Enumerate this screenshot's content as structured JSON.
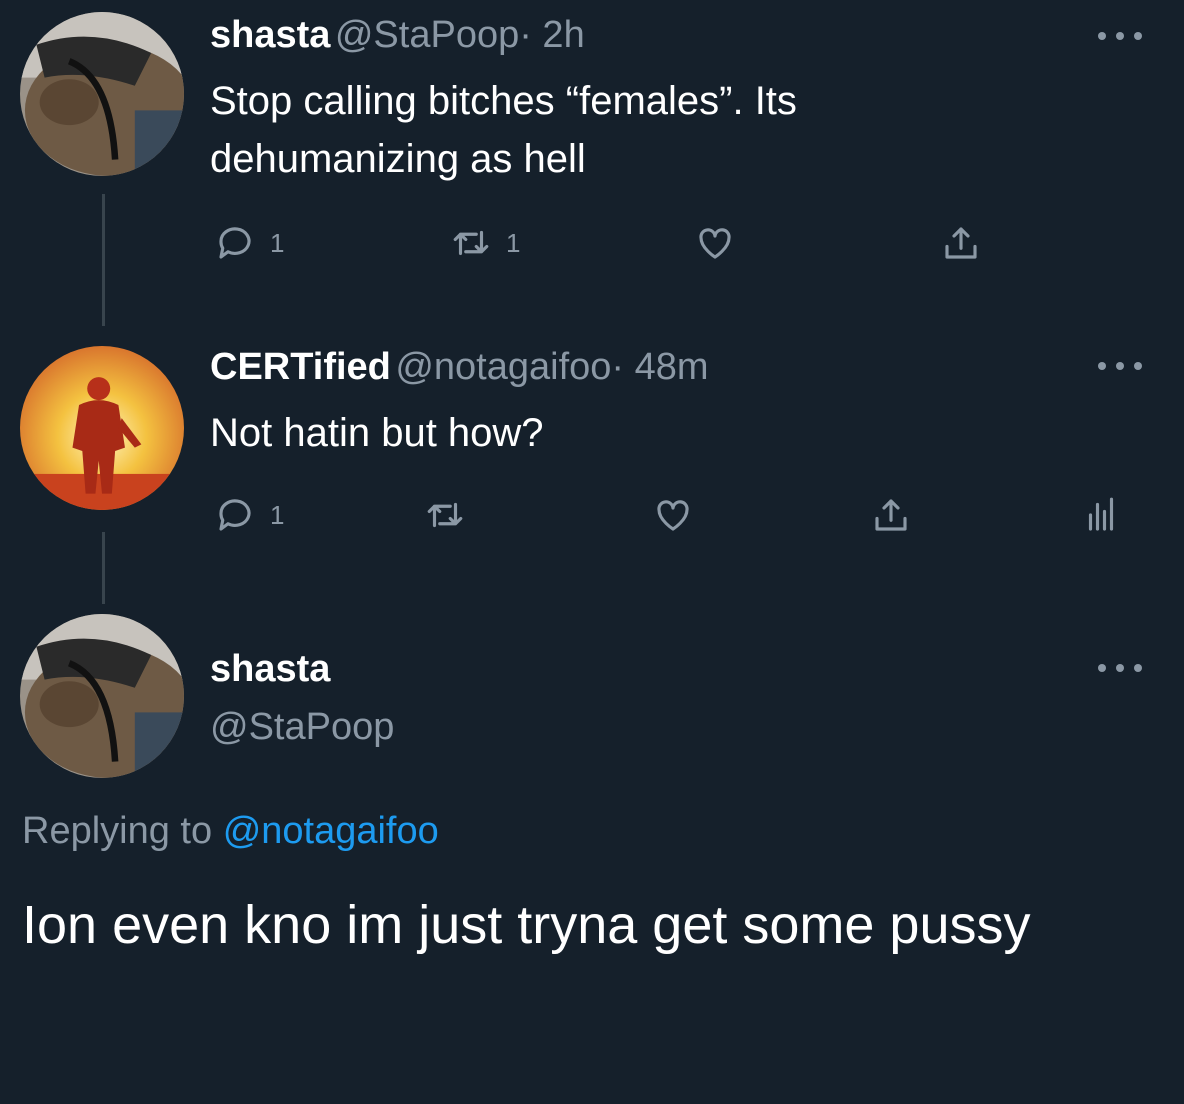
{
  "tweets": [
    {
      "name": "shasta",
      "handle": "@StaPoop",
      "time": "· 2h",
      "text": "Stop calling bitches “females”. Its dehumanizing as hell",
      "reply_count": "1",
      "retweet_count": "1",
      "avatar": "capybara-photo"
    },
    {
      "name": "CERTified",
      "handle": "@notagaifoo",
      "time": "· 48m",
      "text": "Not hatin but how?",
      "reply_count": "1",
      "avatar": "silhouette-sunset-photo"
    }
  ],
  "main_tweet": {
    "name": "shasta",
    "handle": "@StaPoop",
    "replying_label": "Replying to",
    "replying_mention": "@notagaifoo",
    "text": "Ion even kno im just tryna get some pussy"
  },
  "colors": {
    "background": "#15202b",
    "secondary_text": "#8b98a5",
    "link": "#1d9bf0"
  }
}
